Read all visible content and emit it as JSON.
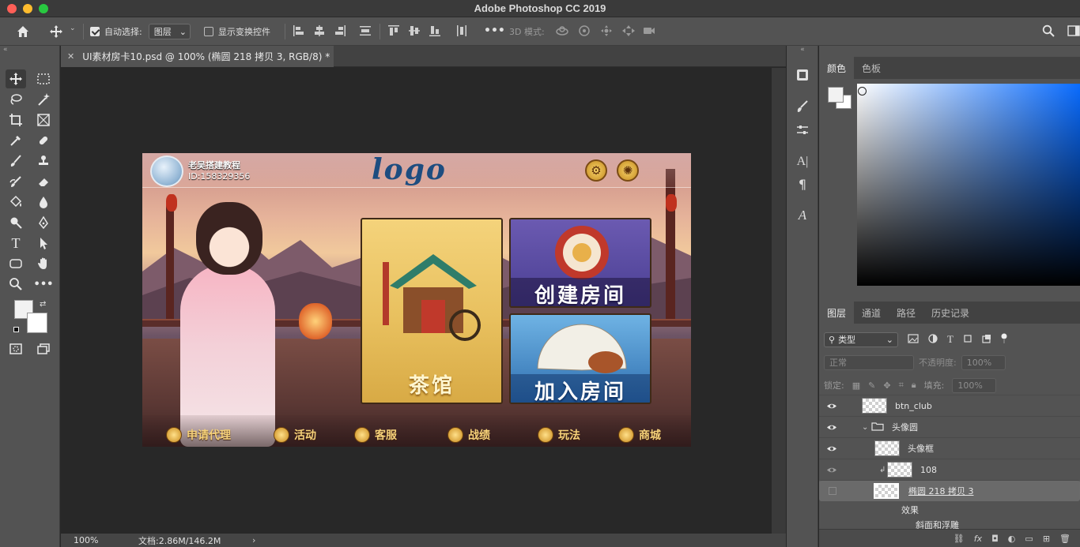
{
  "app": {
    "title": "Adobe Photoshop CC 2019"
  },
  "options_bar": {
    "auto_select_label": "自动选择:",
    "auto_select_checked": true,
    "auto_select_target": "图层",
    "show_transform_label": "显示变换控件",
    "show_transform_checked": false,
    "mode_3d_label": "3D 模式:"
  },
  "document": {
    "tab_title": "UI素材房卡10.psd @ 100% (椭圆 218 拷贝 3, RGB/8) *",
    "zoom": "100%",
    "doc_info": "文档:2.86M/146.2M"
  },
  "artwork": {
    "user_name": "老吴搭建教程",
    "user_id": "ID:158329356",
    "logo": "logo",
    "cards": {
      "tea_house": "茶馆",
      "create_room": "创建房间",
      "join_room": "加入房间"
    },
    "bottom_nav": [
      "申请代理",
      "活动",
      "客服",
      "战绩",
      "玩法",
      "商城"
    ]
  },
  "color_panel": {
    "tabs": [
      "颜色",
      "色板"
    ],
    "active_tab": "颜色",
    "hue_color": "#0a6cff"
  },
  "layers_panel": {
    "tabs": [
      "图层",
      "通道",
      "路径",
      "历史记录"
    ],
    "active_tab": "图层",
    "filter_kind": "类型",
    "blend_mode": "正常",
    "opacity_label": "不透明度:",
    "opacity_value": "100%",
    "lock_label": "锁定:",
    "fill_label": "填充:",
    "fill_value": "100%",
    "layers": [
      {
        "name": "btn_club",
        "visible": true
      },
      {
        "name": "头像圆",
        "visible": true,
        "group": true
      },
      {
        "name": "头像框",
        "visible": true
      },
      {
        "name": "108",
        "visible": true
      },
      {
        "name": "椭圆 218 拷贝 3",
        "visible": false,
        "selected": true
      }
    ],
    "effects_label": "效果",
    "effect_item": "斜面和浮雕"
  }
}
